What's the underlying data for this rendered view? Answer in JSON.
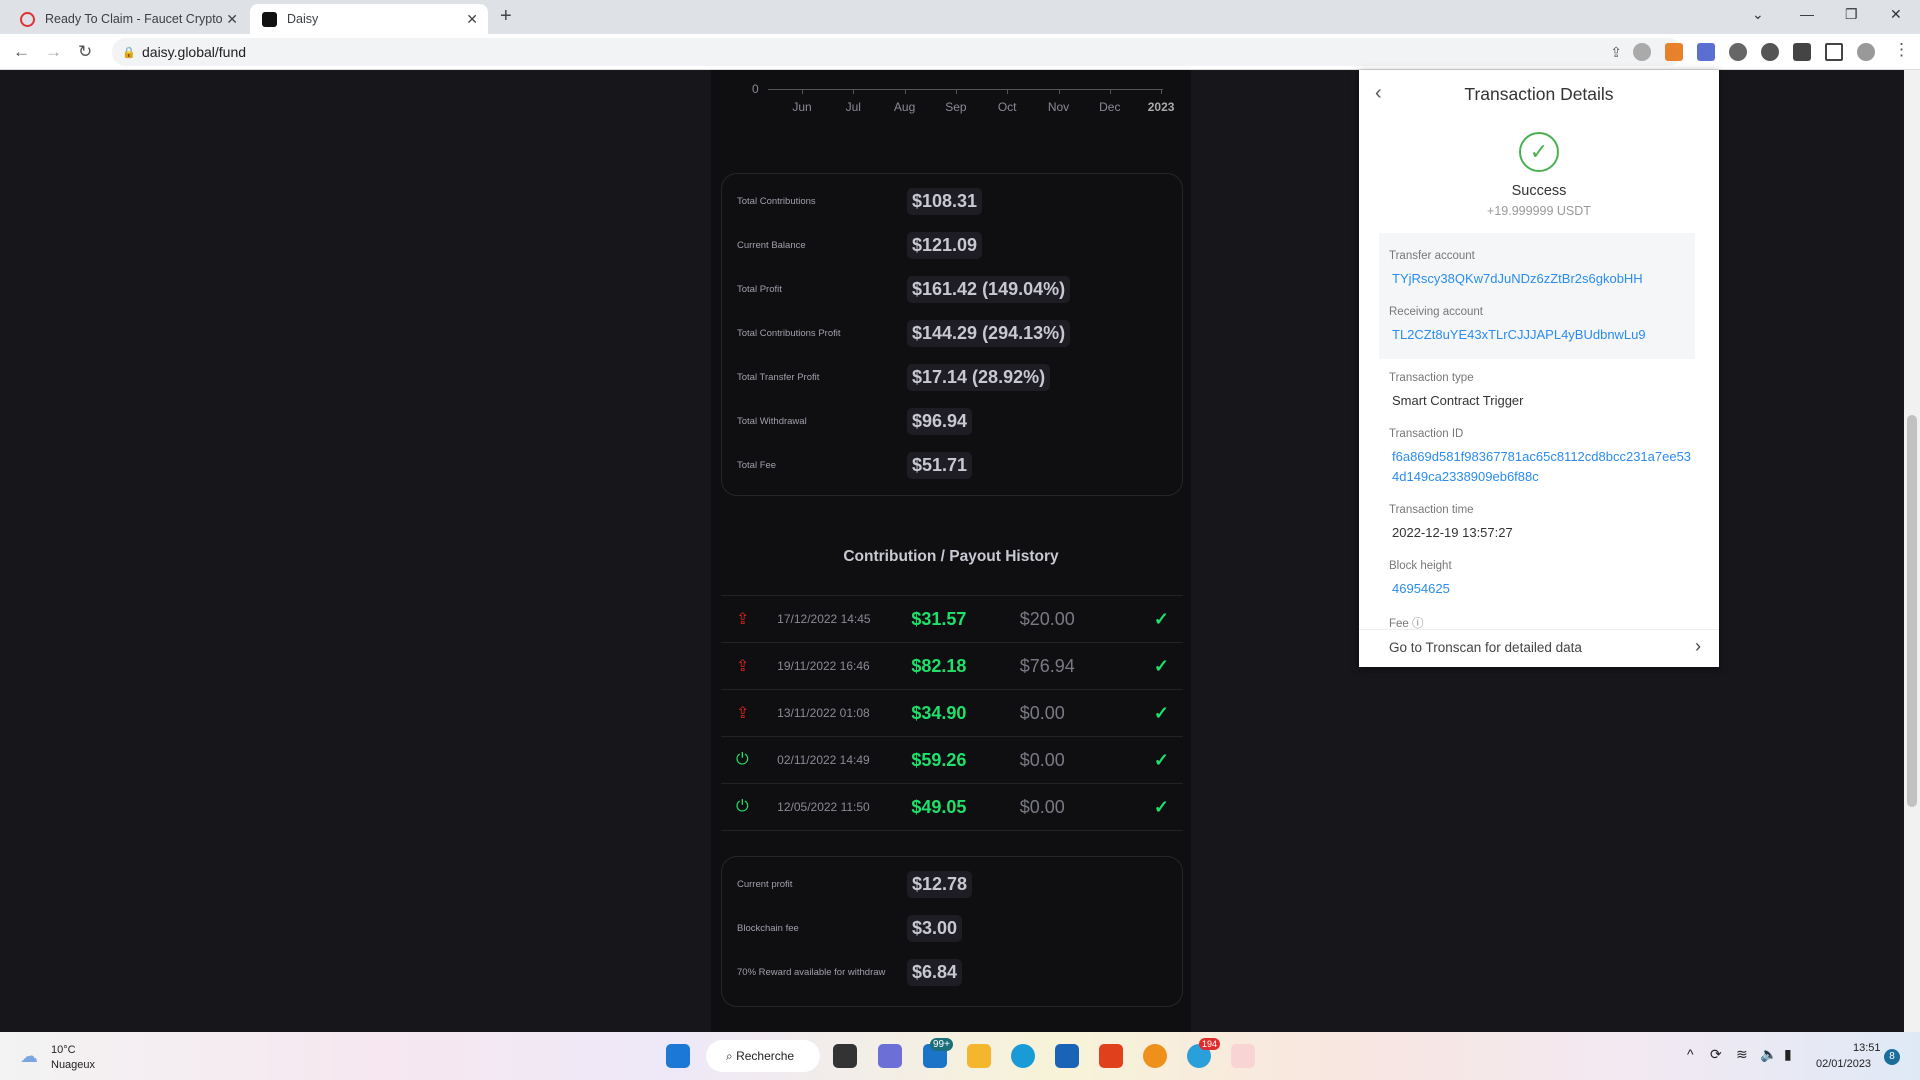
{
  "browser": {
    "tabs": [
      {
        "title": "Ready To Claim - Faucet Crypto"
      },
      {
        "title": "Daisy",
        "active": true
      }
    ],
    "url": "daisy.global/fund"
  },
  "chart_data": {
    "type": "line",
    "x_ticks": [
      "Jun",
      "Jul",
      "Aug",
      "Sep",
      "Oct",
      "Nov",
      "Dec",
      "2023"
    ],
    "y_ticks": [
      "0"
    ]
  },
  "stats": [
    {
      "label": "Total Contributions",
      "value": "$108.31"
    },
    {
      "label": "Current Balance",
      "value": "$121.09"
    },
    {
      "label": "Total Profit",
      "value": "$161.42 (149.04%)"
    },
    {
      "label": "Total Contributions Profit",
      "value": "$144.29 (294.13%)"
    },
    {
      "label": "Total Transfer Profit",
      "value": "$17.14 (28.92%)"
    },
    {
      "label": "Total Withdrawal",
      "value": "$96.94"
    },
    {
      "label": "Total Fee",
      "value": "$51.71"
    }
  ],
  "history": {
    "title": "Contribution / Payout History",
    "rows": [
      {
        "type": "upload",
        "date": "17/12/2022 14:45",
        "amount": "$31.57",
        "payout": "$20.00",
        "status": "success"
      },
      {
        "type": "upload",
        "date": "19/11/2022 16:46",
        "amount": "$82.18",
        "payout": "$76.94",
        "status": "success"
      },
      {
        "type": "upload",
        "date": "13/11/2022 01:08",
        "amount": "$34.90",
        "payout": "$0.00",
        "status": "success"
      },
      {
        "type": "download",
        "date": "02/11/2022 14:49",
        "amount": "$59.26",
        "payout": "$0.00",
        "status": "success"
      },
      {
        "type": "download",
        "date": "12/05/2022 11:50",
        "amount": "$49.05",
        "payout": "$0.00",
        "status": "success"
      }
    ]
  },
  "rewards": [
    {
      "label": "Current profit",
      "value": "$12.78"
    },
    {
      "label": "Blockchain fee",
      "value": "$3.00"
    },
    {
      "label": "70% Reward available for withdraw",
      "value": "$6.84"
    }
  ],
  "panel": {
    "title": "Transaction Details",
    "status": "Success",
    "amount": "+19.999999 USDT",
    "transfer_label": "Transfer account",
    "transfer": "TYjRscy38QKw7dJuNDz6zZtBr2s6gkobHH",
    "receiving_label": "Receiving account",
    "receiving": "TL2CZt8uYE43xTLrCJJJAPL4yBUdbnwLu9",
    "type_label": "Transaction type",
    "type": "Smart Contract Trigger",
    "id_label": "Transaction ID",
    "id": "f6a869d581f98367781ac65c8112cd8bcc231a7ee534d149ca2338909eb6f88c",
    "time_label": "Transaction time",
    "time": "2022-12-19 13:57:27",
    "block_label": "Block height",
    "block": "46954625",
    "fee_label": "Fee",
    "footer": "Go to Tronscan for detailed data"
  },
  "taskbar": {
    "temp": "10°C",
    "weather": "Nuageux",
    "search": "Recherche",
    "mail_badge": "99+",
    "telegram_badge": "194",
    "time": "13:51",
    "date": "02/01/2023",
    "notif": "8"
  },
  "colors": {
    "green": "#1ee06a",
    "red": "#e0241c",
    "link": "#2a8cf0"
  }
}
